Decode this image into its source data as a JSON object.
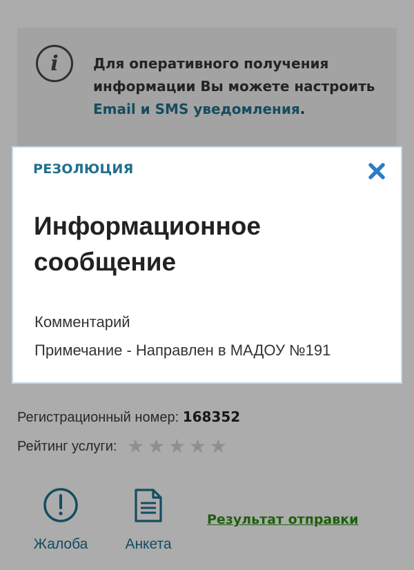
{
  "banner": {
    "text_before": "Для оперативного получения информации Вы можете настроить ",
    "link_text": "Email и SMS уведомления",
    "text_after": "."
  },
  "details": {
    "reg_label": "Регистрационный номер:",
    "reg_number": "168352",
    "rating_label": "Рейтинг услуги:",
    "rating_value": 0,
    "rating_max": 5,
    "star_glyph": "★"
  },
  "actions": {
    "complaint_label": "Жалоба",
    "survey_label": "Анкета",
    "result_link": "Результат отправки"
  },
  "modal": {
    "header": "РЕЗОЛЮЦИЯ",
    "title": "Информационное сообщение",
    "comment": "Комментарий",
    "note": "Примечание - Направлен в МАДОУ №191"
  },
  "colors": {
    "accent": "#1f6f8b",
    "close_icon": "#2a7dc6",
    "link_green": "#2a8a12",
    "star_empty": "#cfcfcf"
  }
}
